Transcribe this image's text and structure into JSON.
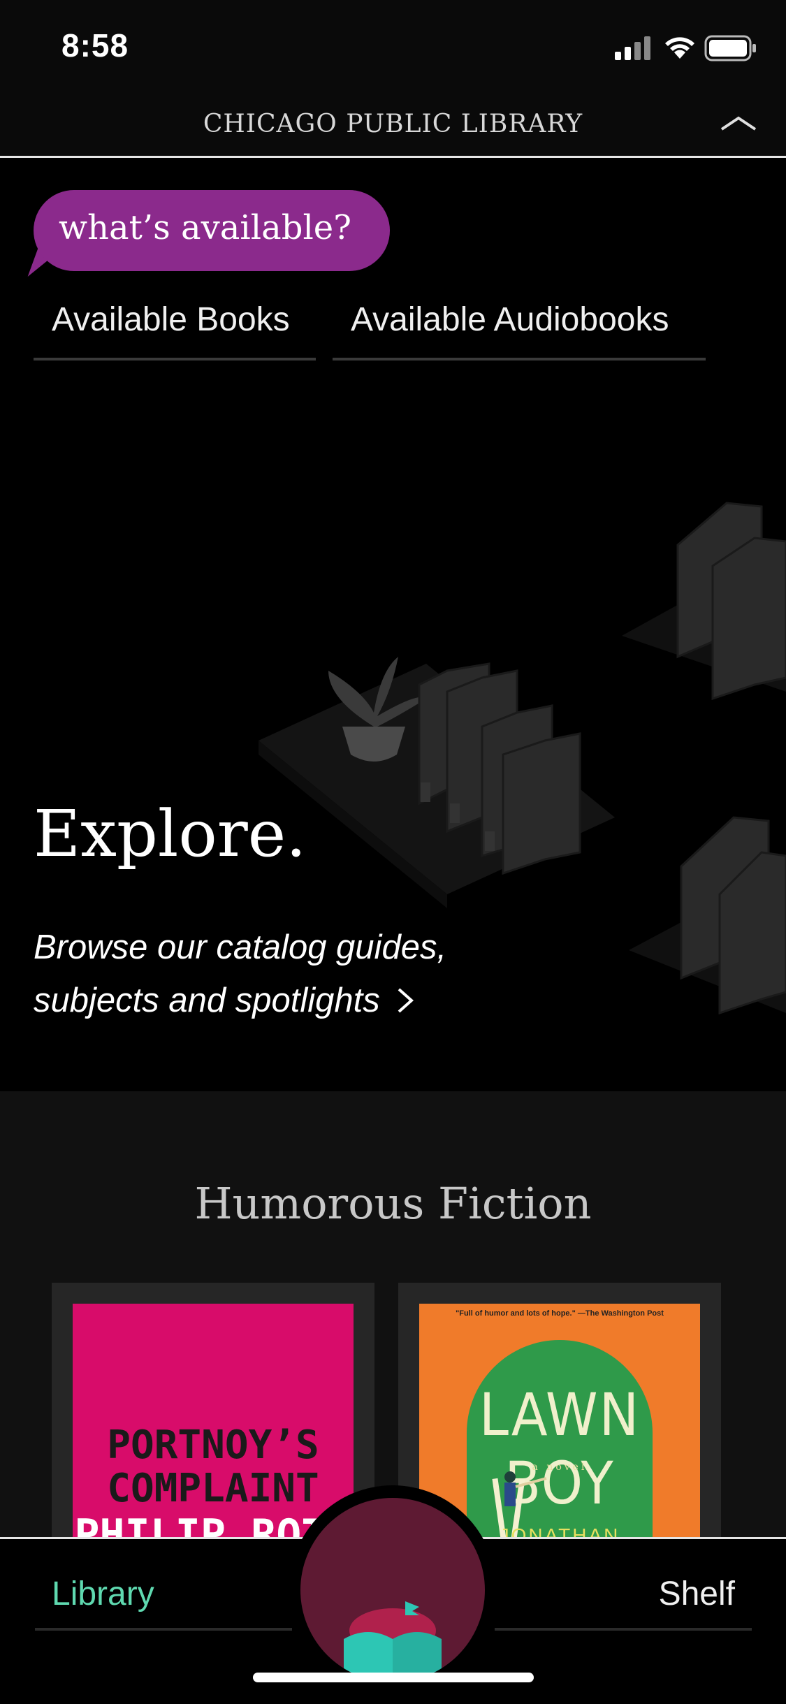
{
  "status_bar": {
    "time": "8:58"
  },
  "header": {
    "title": "CHICAGO PUBLIC LIBRARY"
  },
  "bubble": {
    "text": "what’s available?"
  },
  "quick_links": [
    "Available Books",
    "Available Audiobooks"
  ],
  "explore": {
    "title": "Explore.",
    "subtitle_line1": "Browse our catalog guides,",
    "subtitle_line2": "subjects and spotlights"
  },
  "collection": {
    "title": "Humorous Fiction",
    "books": [
      {
        "cover_line1": "PORTNOY’S",
        "cover_line2": "COMPLAINT",
        "cover_author": "PHILIP ROTH",
        "cover_color": "#d80c6a"
      },
      {
        "blurb": "\"Full of humor and lots of hope.\" —The Washington Post",
        "cover_title": "LAWN BOY",
        "subtitle": "a novel",
        "cover_author": "JONATHAN",
        "cover_color": "#f07b2a"
      }
    ]
  },
  "bottom_nav": {
    "library": "Library",
    "shelf": "Shelf"
  },
  "colors": {
    "accent": "#5fd9b0",
    "bubble": "#8b2a8c",
    "center_button": "#5e1a33"
  }
}
